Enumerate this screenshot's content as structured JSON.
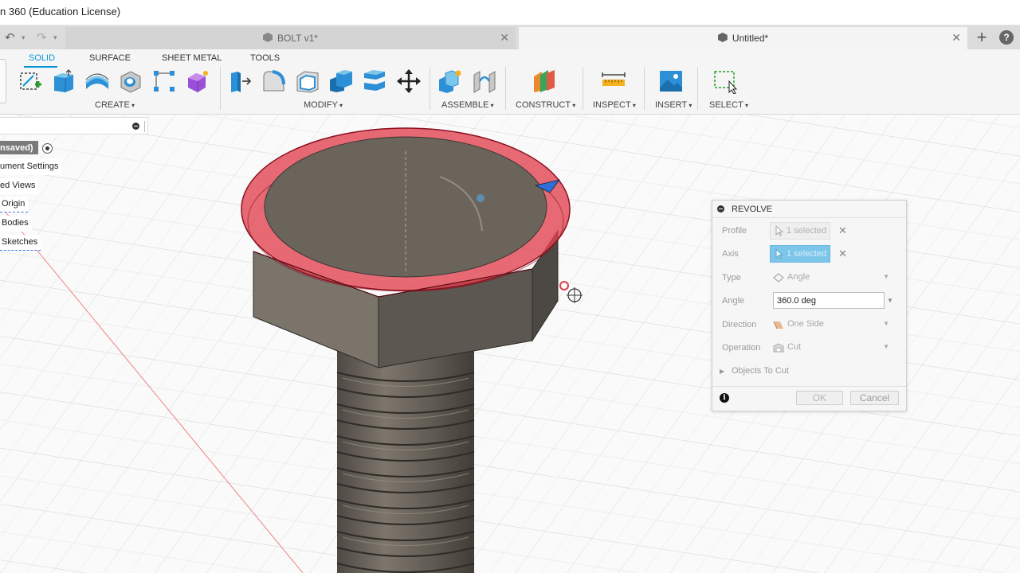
{
  "window": {
    "title": "n 360 (Education License)"
  },
  "tabs": [
    {
      "label": "BOLT v1*",
      "active": false
    },
    {
      "label": "Untitled*",
      "active": true
    }
  ],
  "quick_access": {
    "undo": "↶",
    "redo": "↷",
    "dropdown": "▾",
    "add_tab": "+",
    "help": "?"
  },
  "workspace_tabs": [
    "SOLID",
    "SURFACE",
    "SHEET METAL",
    "TOOLS"
  ],
  "toolbar_groups": [
    "CREATE",
    "MODIFY",
    "ASSEMBLE",
    "CONSTRUCT",
    "INSPECT",
    "INSERT",
    "SELECT"
  ],
  "browser": {
    "nodes": [
      {
        "label": "nsaved)"
      },
      {
        "label": "ument Settings"
      },
      {
        "label": "ed Views"
      },
      {
        "label": "Origin"
      },
      {
        "label": "Bodies"
      },
      {
        "label": "Sketches"
      }
    ]
  },
  "revolve": {
    "title": "REVOLVE",
    "profile": {
      "label": "Profile",
      "value": "1 selected"
    },
    "axis": {
      "label": "Axis",
      "value": "1 selected"
    },
    "type": {
      "label": "Type",
      "value": "Angle"
    },
    "angle": {
      "label": "Angle",
      "value": "360.0 deg"
    },
    "direction": {
      "label": "Direction",
      "value": "One Side"
    },
    "operation": {
      "label": "Operation",
      "value": "Cut"
    },
    "objects_to_cut": "Objects To Cut",
    "ok": "OK",
    "cancel": "Cancel",
    "info": "i"
  },
  "colors": {
    "accent": "#0696d7",
    "profile_highlight": "#e0404e",
    "model_metal": "#6e675e",
    "axis_selected": "#7cc6ea"
  }
}
